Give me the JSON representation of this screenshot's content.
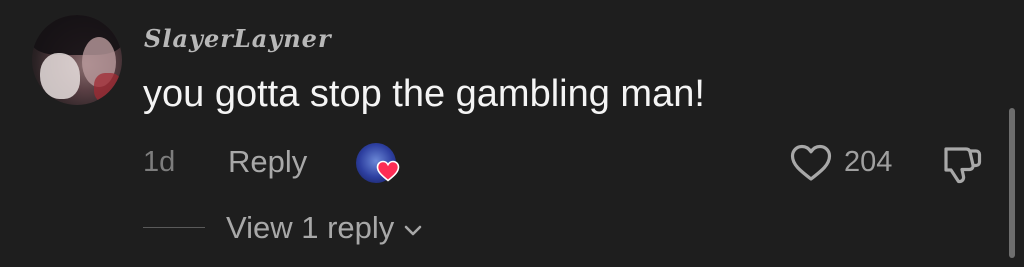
{
  "comment": {
    "username": "SlayerLayner",
    "text": "you gotta stop the gambling man!",
    "timestamp": "1d",
    "reply_label": "Reply",
    "like_count": "204",
    "view_replies_label": "View 1 reply"
  },
  "icons": {
    "like": "heart-outline-icon",
    "dislike": "thumbs-down-icon",
    "creator_liked": "creator-liked-heart-icon",
    "expand": "chevron-down-icon"
  },
  "colors": {
    "background": "#1e1e1e",
    "text_primary": "#f4f4f4",
    "text_secondary": "#a8a8a8",
    "heart_red": "#fe2c55"
  }
}
